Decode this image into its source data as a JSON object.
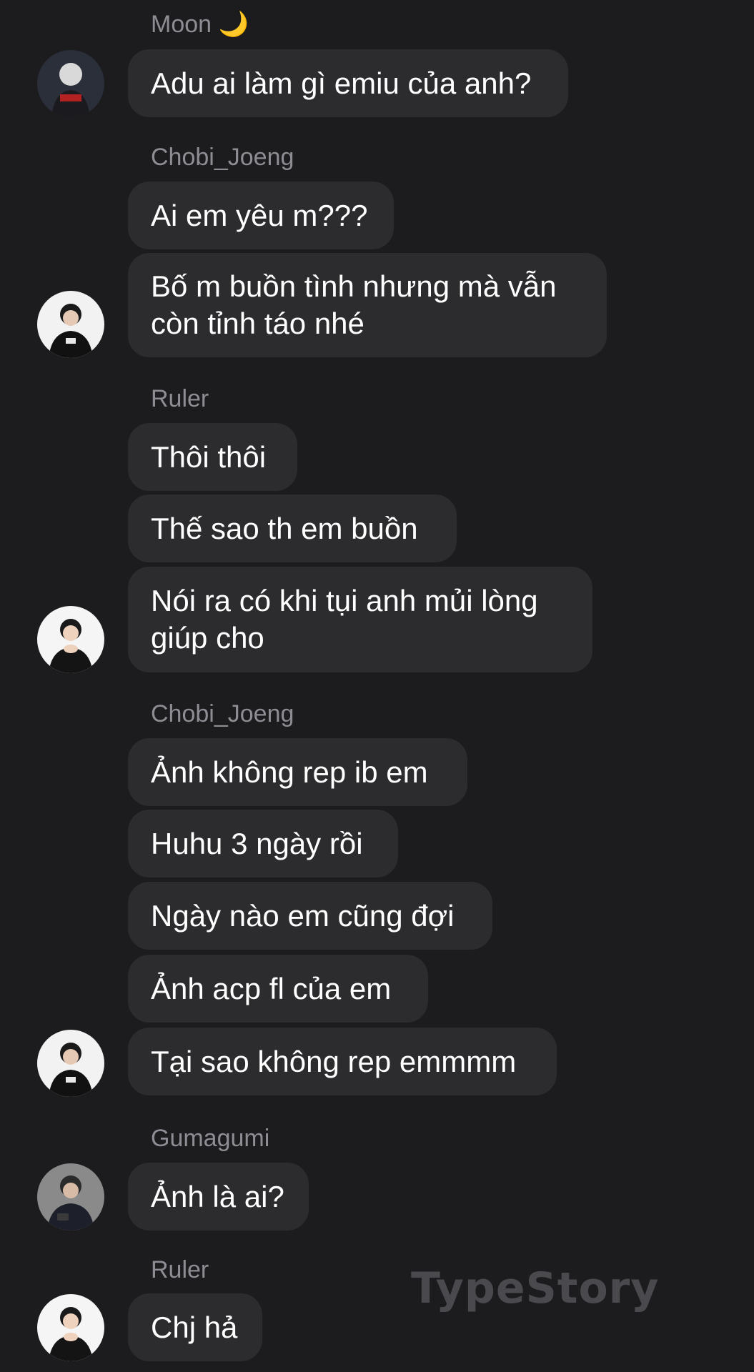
{
  "watermark": "TypeStory",
  "colors": {
    "background": "#1c1c1e",
    "bubble": "#2c2c2e",
    "sender_name": "#8d8d93",
    "text": "#ffffff"
  },
  "groups": [
    {
      "sender": "Moon",
      "sender_emoji": "🌙",
      "avatar": "avatar-moon",
      "messages": [
        "Adu ai làm gì emiu của anh?"
      ]
    },
    {
      "sender": "Chobi_Joeng",
      "avatar": "avatar-chobi",
      "messages": [
        "Ai em yêu m???",
        "Bố m buồn tình nhưng mà vẫn còn tỉnh táo nhé"
      ]
    },
    {
      "sender": "Ruler",
      "avatar": "avatar-ruler",
      "messages": [
        "Thôi thôi",
        "Thế sao th em buồn",
        "Nói ra có khi tụi anh mủi lòng giúp cho"
      ]
    },
    {
      "sender": "Chobi_Joeng",
      "avatar": "avatar-chobi",
      "messages": [
        "Ảnh không rep ib em",
        "Huhu 3 ngày rồi",
        "Ngày nào em cũng đợi",
        "Ảnh acp fl của em",
        "Tại sao không rep emmmm"
      ]
    },
    {
      "sender": "Gumagumi",
      "avatar": "avatar-gumagumi",
      "messages": [
        "Ảnh là ai?"
      ]
    },
    {
      "sender": "Ruler",
      "avatar": "avatar-ruler",
      "messages": [
        "Chj hả"
      ]
    }
  ]
}
